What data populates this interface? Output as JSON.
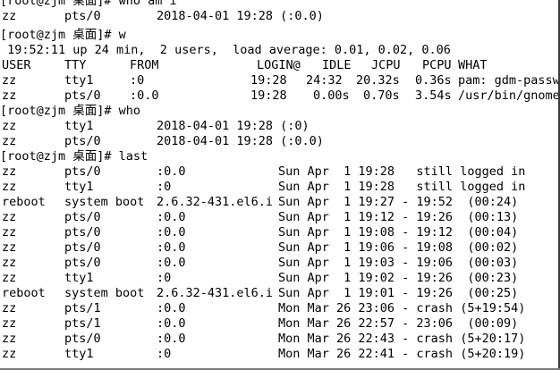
{
  "colors": {
    "background": "#ffffff",
    "foreground": "#000000",
    "edge": "#3c3c3c"
  },
  "session": {
    "prompt1": "[root@zjm 桌面]# who am i",
    "whoami": [
      "zz",
      "pts/0",
      "2018-04-01 19:28 (:0.0)"
    ],
    "prompt2": "[root@zjm 桌面]# w",
    "w_uptime": " 19:52:11 up 24 min,  2 users,  load average: 0.01, 0.02, 0.06",
    "w_header": [
      "USER",
      "TTY",
      "FROM",
      "LOGIN@",
      "IDLE",
      "JCPU",
      "PCPU",
      "WHAT"
    ],
    "w_rows": [
      [
        "zz",
        "tty1",
        ":0",
        "19:28",
        "24:32",
        "20.32s",
        "0.36s",
        "pam: gdm-passwo"
      ],
      [
        "zz",
        "pts/0",
        ":0.0",
        "19:28",
        "0.00s",
        "0.70s",
        "3.54s",
        "/usr/bin/gnome-"
      ]
    ],
    "prompt3": "[root@zjm 桌面]# who",
    "who_rows": [
      [
        "zz",
        "tty1",
        "2018-04-01 19:28 (:0)"
      ],
      [
        "zz",
        "pts/0",
        "2018-04-01 19:28 (:0.0)"
      ]
    ],
    "prompt4": "[root@zjm 桌面]# last",
    "last_rows": [
      [
        "zz",
        "pts/0",
        ":0.0",
        "Sun Apr  1 19:28   still logged in"
      ],
      [
        "zz",
        "tty1",
        ":0",
        "Sun Apr  1 19:28   still logged in"
      ],
      [
        "reboot",
        "system boot",
        "2.6.32-431.el6.i",
        "Sun Apr  1 19:27 - 19:52  (00:24)"
      ],
      [
        "zz",
        "pts/0",
        ":0.0",
        "Sun Apr  1 19:12 - 19:26  (00:13)"
      ],
      [
        "zz",
        "pts/0",
        ":0.0",
        "Sun Apr  1 19:08 - 19:12  (00:04)"
      ],
      [
        "zz",
        "pts/0",
        ":0.0",
        "Sun Apr  1 19:06 - 19:08  (00:02)"
      ],
      [
        "zz",
        "pts/0",
        ":0.0",
        "Sun Apr  1 19:03 - 19:06  (00:03)"
      ],
      [
        "zz",
        "tty1",
        ":0",
        "Sun Apr  1 19:02 - 19:26  (00:23)"
      ],
      [
        "reboot",
        "system boot",
        "2.6.32-431.el6.i",
        "Sun Apr  1 19:01 - 19:26  (00:25)"
      ],
      [
        "zz",
        "pts/1",
        ":0.0",
        "Mon Mar 26 23:06 - crash (5+19:54)"
      ],
      [
        "zz",
        "pts/1",
        ":0.0",
        "Mon Mar 26 22:57 - 23:06  (00:09)"
      ],
      [
        "zz",
        "pts/0",
        ":0.0",
        "Mon Mar 26 22:43 - crash (5+20:17)"
      ],
      [
        "zz",
        "tty1",
        ":0",
        "Mon Mar 26 22:41 - crash (5+20:19)"
      ]
    ]
  }
}
